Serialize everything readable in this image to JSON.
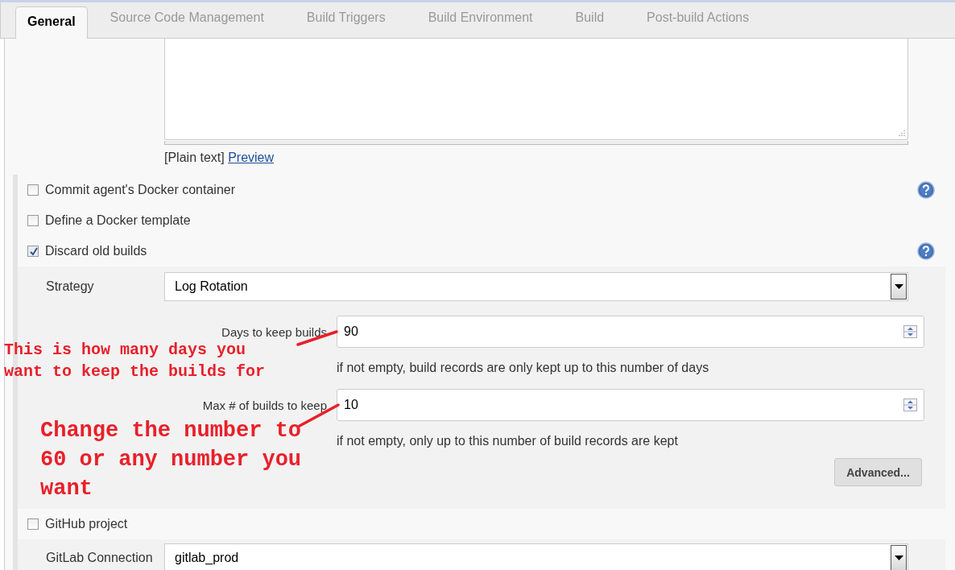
{
  "tabs": [
    {
      "label": "General",
      "selected": true
    },
    {
      "label": "Source Code Management",
      "selected": false
    },
    {
      "label": "Build Triggers",
      "selected": false
    },
    {
      "label": "Build Environment",
      "selected": false
    },
    {
      "label": "Build",
      "selected": false
    },
    {
      "label": "Post-build Actions",
      "selected": false
    }
  ],
  "description": {
    "format": "[Plain text]",
    "preview_link": "Preview"
  },
  "options": [
    {
      "label": "Commit agent's Docker container",
      "checked": false,
      "help": true
    },
    {
      "label": "Define a Docker template",
      "checked": false,
      "help": false
    },
    {
      "label": "Discard old builds",
      "checked": true,
      "help": true,
      "settings": {
        "strategy_label": "Strategy",
        "strategy": "Log Rotation",
        "fields": [
          {
            "label": "Days to keep builds",
            "value": "90",
            "hint": "if not empty, build records are only kept up to this number of days"
          },
          {
            "label": "Max # of builds to keep",
            "value": "10",
            "hint": "if not empty, only up to this number of build records are kept"
          }
        ],
        "advanced_button": "Advanced..."
      }
    },
    {
      "label": "GitHub project",
      "checked": false,
      "help": false
    }
  ],
  "gitlab_connection": {
    "label": "GitLab Connection",
    "value": "gitlab_prod"
  },
  "annotations": [
    {
      "text": "This is how many days you want to keep the builds for",
      "kind": "small"
    },
    {
      "text": "Change the number to 60 or any number you want",
      "kind": "large"
    }
  ]
}
